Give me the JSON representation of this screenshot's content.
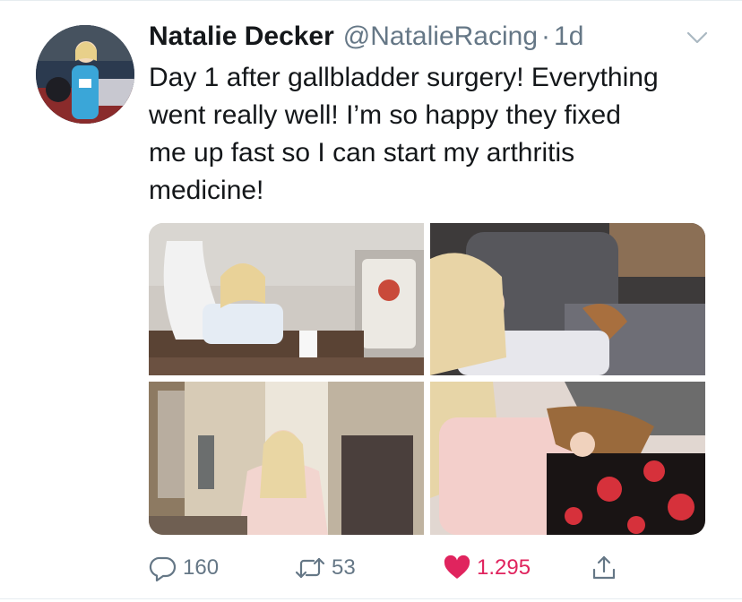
{
  "tweet": {
    "author_name": "Natalie Decker",
    "handle": "@NatalieRacing",
    "separator": "·",
    "time": "1d",
    "text_lines": [
      "Day 1 after gallbladder surgery! Everything",
      "went really well! I’m so happy they fixed",
      "me up fast so I can start my arthritis",
      "medicine!"
    ]
  },
  "media": {
    "photo_count": 4
  },
  "actions": {
    "reply_count": "160",
    "retweet_count": "53",
    "like_count": "1.295",
    "liked": true
  },
  "icons": {
    "menu": "chevron-down-icon",
    "reply": "speech-bubble-icon",
    "retweet": "retweet-arrows-icon",
    "like": "heart-icon",
    "share": "share-upload-icon"
  },
  "colors": {
    "text": "#14171a",
    "secondary": "#657786",
    "like": "#e0245e",
    "divider": "#e6ecf0"
  }
}
